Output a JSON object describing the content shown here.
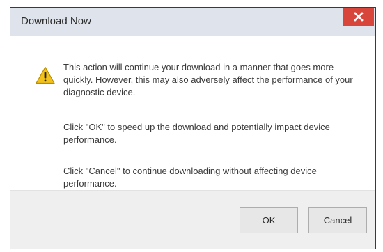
{
  "dialog": {
    "title": "Download Now",
    "icon": "warning-triangle-icon",
    "close_icon": "close-icon",
    "close_button_color": "#d8453a",
    "messages": [
      "This action will continue your download in a manner that goes more quickly. However, this may also adversely affect the performance of your diagnostic device.",
      "Click \"OK\" to speed up the download and potentially impact device performance.",
      "Click \"Cancel\" to continue downloading without affecting device performance."
    ],
    "buttons": {
      "ok_label": "OK",
      "cancel_label": "Cancel"
    }
  }
}
